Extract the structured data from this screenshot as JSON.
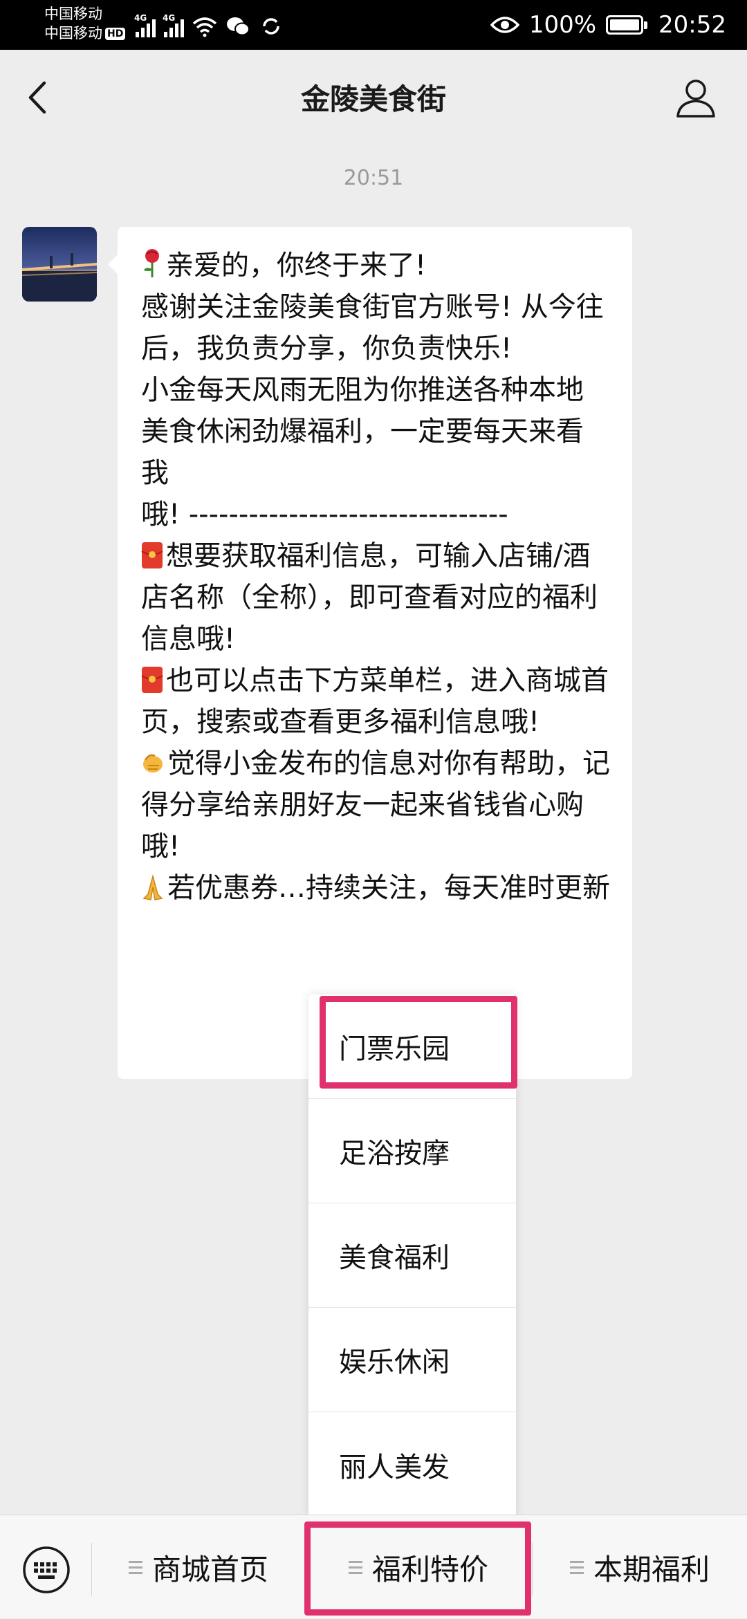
{
  "status_bar": {
    "carrier_1": "中国移动",
    "carrier_2": "中国移动",
    "hd_label": "HD",
    "network_1": "4G",
    "network_2": "4G",
    "battery": "100%",
    "time": "20:52"
  },
  "nav": {
    "title": "金陵美食街",
    "back_icon": "chevron-left",
    "profile_icon": "person-outline"
  },
  "chat": {
    "timestamp": "20:51",
    "message_lines": [
      "亲爱的，你终于来了!",
      "感谢关注金陵美食街官方账号! 从今往后，我负责分享，你负责快乐!",
      "小金每天风雨无阻为你推送各种本地美食休闲劲爆福利，一定要每天来看我",
      "哦! --------------------------------",
      "想要获取福利信息，可输入店铺/酒店名称（全称），即可查看对应的福利信息哦!",
      "也可以点击下方菜单栏，进入商城首页，搜索或查看更多福利信息哦!",
      "觉得小金发布的信息对你有帮助，记得分享给亲朋好友一起来省钱省心购哦!",
      "若优惠券…持续关注，每天准时更新"
    ],
    "emojis": [
      "rose",
      "red-envelope",
      "red-envelope",
      "hand",
      "folded-hands"
    ]
  },
  "popup_menu": {
    "items": [
      "门票乐园",
      "足浴按摩",
      "美食福利",
      "娱乐休闲",
      "丽人美发"
    ]
  },
  "bottom_menu": {
    "tabs": [
      "商城首页",
      "福利特价",
      "本期福利"
    ]
  },
  "colors": {
    "background": "#ededed",
    "highlight": "#e0306e",
    "bubble": "#ffffff"
  }
}
